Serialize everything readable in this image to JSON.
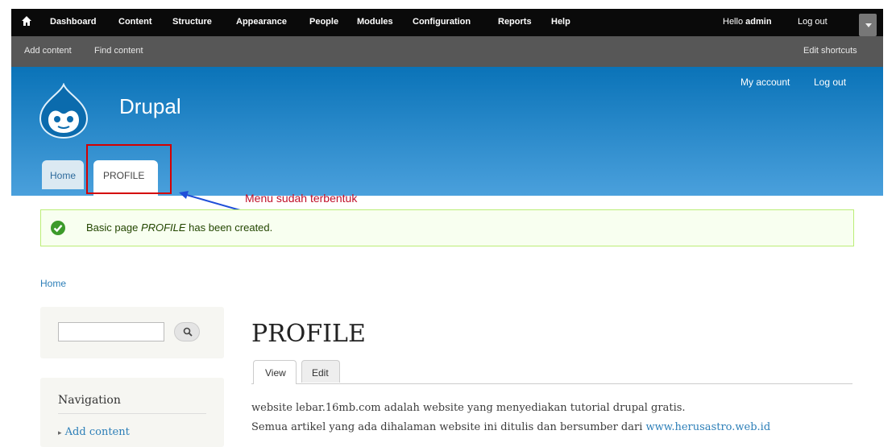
{
  "toolbar": {
    "items": [
      "Dashboard",
      "Content",
      "Structure",
      "Appearance",
      "People",
      "Modules",
      "Configuration",
      "Reports",
      "Help"
    ],
    "hello_prefix": "Hello",
    "hello_user": "admin",
    "logout": "Log out"
  },
  "shortcuts": {
    "add_content": "Add content",
    "find_content": "Find content",
    "edit_shortcuts": "Edit shortcuts"
  },
  "header": {
    "site_name": "Drupal",
    "secondary": [
      "My account",
      "Log out"
    ],
    "tabs": [
      "Home",
      "PROFILE"
    ],
    "accent": "#0a73b8"
  },
  "annotation": "Menu sudah terbentuk",
  "message": {
    "before": "Basic page ",
    "title": "PROFILE",
    "after": " has been created."
  },
  "breadcrumb": "Home",
  "sidebar": {
    "search_placeholder": "",
    "navigation_title": "Navigation",
    "nav_items": [
      "Add content"
    ]
  },
  "content": {
    "title": "PROFILE",
    "local_tabs": [
      "View",
      "Edit"
    ],
    "line1": "website lebar.16mb.com adalah website yang menyediakan tutorial drupal gratis.",
    "line2_text": "Semua artikel yang ada dihalaman website ini ditulis dan bersumber dari ",
    "line2_link": "www.herusastro.web.id"
  }
}
